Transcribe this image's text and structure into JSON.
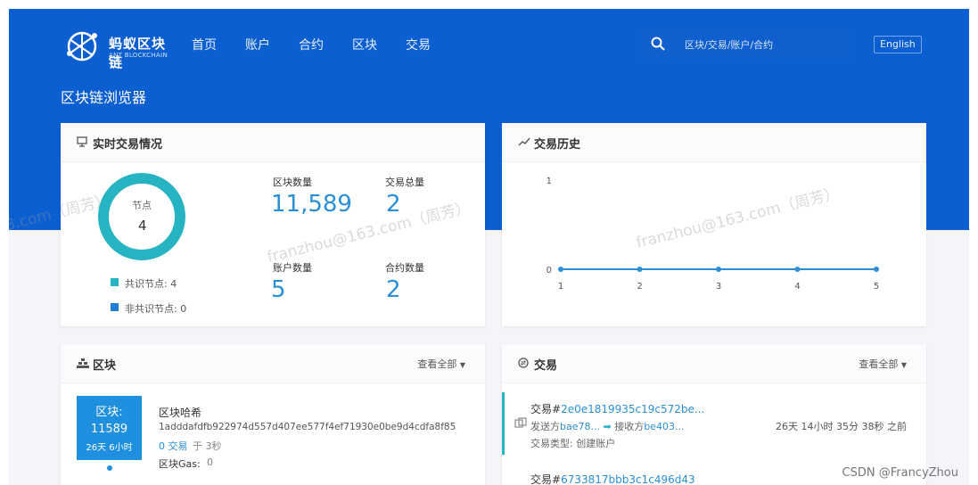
{
  "brand": {
    "name": "蚂蚁区块链",
    "sub": "ANT BLOCKCHAIN"
  },
  "nav": [
    "首页",
    "账户",
    "合约",
    "区块",
    "交易"
  ],
  "search": {
    "placeholder": "区块/交易/账户/合约"
  },
  "lang_button": "English",
  "page_title": "区块链浏览器",
  "realtime": {
    "title": "实时交易情况",
    "donut": {
      "label": "节点",
      "value": "4"
    },
    "legend": [
      {
        "label": "共识节点: 4",
        "color": "#26b3c2"
      },
      {
        "label": "非共识节点: 0",
        "color": "#1f7fd6"
      }
    ],
    "stats": [
      {
        "label": "区块数量",
        "value": "11,589"
      },
      {
        "label": "交易总量",
        "value": "2"
      },
      {
        "label": "账户数量",
        "value": "5"
      },
      {
        "label": "合约数量",
        "value": "2"
      }
    ]
  },
  "history": {
    "title": "交易历史"
  },
  "chart_data": {
    "type": "line",
    "title": "",
    "x": [
      1,
      2,
      3,
      4,
      5
    ],
    "series": [
      {
        "values": [
          0,
          0,
          0,
          0,
          0
        ]
      }
    ],
    "ylim": [
      0,
      1
    ],
    "yticks": [
      "0",
      "1"
    ],
    "xticks": [
      "1",
      "2",
      "3",
      "4",
      "5"
    ],
    "color": "#2b8fd6"
  },
  "blocks": {
    "title": "区块",
    "view_all": "查看全部",
    "item": {
      "badge_title": "区块:",
      "badge_number": "11589",
      "badge_time": "26天 6小时",
      "hash_label": "区块哈希",
      "hash": "1adddafdfb922974d557d407ee577f4ef71930e0be9d4cdfa8f85",
      "tx_count": "0 交易",
      "tx_time": "于 3秒",
      "gas_label": "区块Gas:",
      "gas_value": "0"
    }
  },
  "transactions": {
    "title": "交易",
    "view_all": "查看全部",
    "items": [
      {
        "title_prefix": "交易#",
        "hash": "2e0e1819935c19c572be...",
        "sender_label": "发送方",
        "sender": "bae78...",
        "receiver_label": "接收方",
        "receiver": "be403...",
        "type_label": "交易类型:",
        "type_value": "创建账户",
        "time": "26天 14小时 35分 38秒 之前"
      },
      {
        "title_prefix": "交易#",
        "hash": "6733817bbb3c1c496d43"
      }
    ]
  },
  "watermark": "franzhou@163.com（周芳）",
  "watermark_left": "3.com（周芳）",
  "credit": "CSDN @FrancyZhou"
}
